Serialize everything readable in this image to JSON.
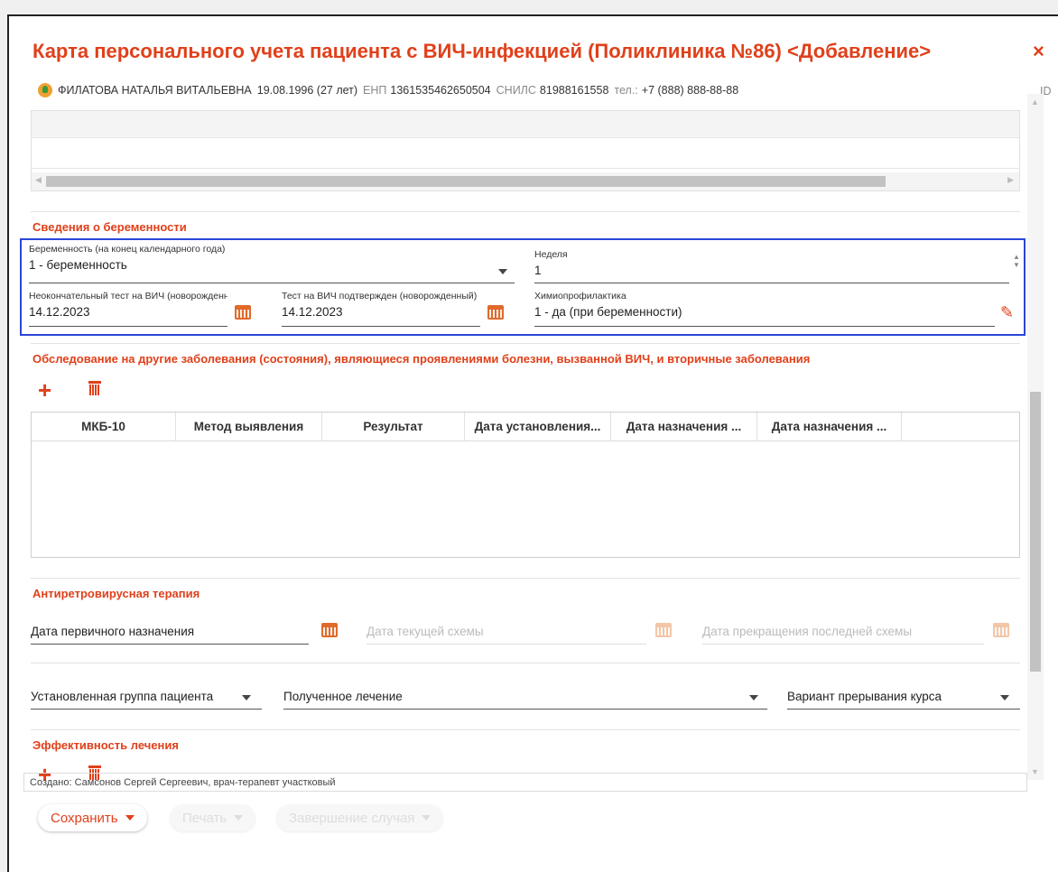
{
  "dialog": {
    "title": "Карта персонального учета пациента с ВИЧ-инфекцией (Поликлиника №86) <Добавление>",
    "close_label": "×"
  },
  "patient": {
    "name": "ФИЛАТОВА НАТАЛЬЯ ВИТАЛЬЕВНА",
    "birth": "19.08.1996 (27 лет)",
    "enp_label": "ЕНП",
    "enp": "1361535462650504",
    "snils_label": "СНИЛС",
    "snils": "81988161558",
    "phone_label": "тел.:",
    "phone": "+7 (888) 888-88-88",
    "id_label": "ID -"
  },
  "pregnancy": {
    "section_title": "Сведения о беременности",
    "pregnancy_label": "Беременность (на конец календарного года)",
    "pregnancy_value": "1 - беременность",
    "week_label": "Неделя",
    "week_value": "1",
    "prelim_test_label": "Неокончательный тест на ВИЧ (новорожденный)",
    "prelim_test_value": "14.12.2023",
    "confirmed_test_label": "Тест на ВИЧ подтвержден (новорожденный)",
    "confirmed_test_value": "14.12.2023",
    "chemo_label": "Химиопрофилактика",
    "chemo_value": "1 - да (при беременности)"
  },
  "exam": {
    "section_title": "Обследование на другие заболевания (состояния), являющиеся проявлениями болезни, вызванной ВИЧ, и вторичные заболевания",
    "columns": [
      "МКБ-10",
      "Метод выявления",
      "Результат",
      "Дата установления...",
      "Дата назначения ...",
      "Дата назначения ..."
    ]
  },
  "art": {
    "section_title": "Антиретровирусная терапия",
    "first_date_placeholder": "Дата первичного назначения",
    "current_scheme_placeholder": "Дата текущей схемы",
    "stop_scheme_placeholder": "Дата прекращения последней схемы",
    "group_placeholder": "Установленная группа пациента",
    "treatment_placeholder": "Полученное лечение",
    "interrupt_placeholder": "Вариант прерывания курса"
  },
  "efficacy": {
    "section_title": "Эффективность лечения"
  },
  "footer": {
    "created_text": "Создано:  Самсонов Сергей Сергеевич, врач-терапевт участковый",
    "save_label": "Сохранить",
    "print_label": "Печать",
    "finish_label": "Завершение случая"
  },
  "colors": {
    "accent": "#e0401a",
    "highlight_border": "#2a46d8"
  }
}
